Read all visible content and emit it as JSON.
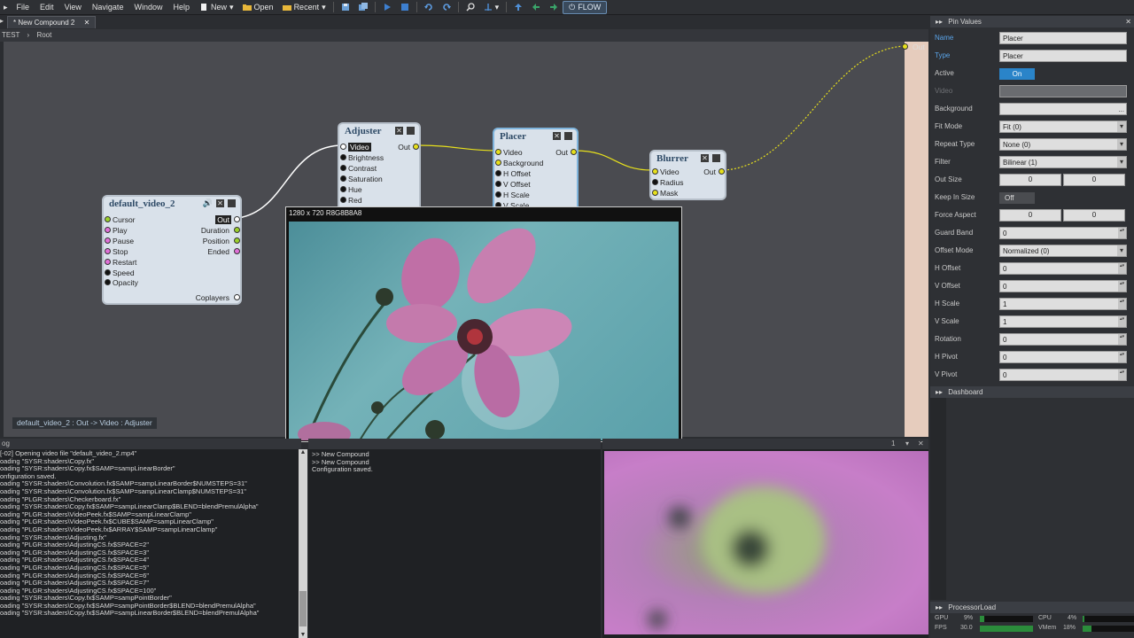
{
  "menu": [
    "File",
    "Edit",
    "View",
    "Navigate",
    "Window",
    "Help"
  ],
  "toolbar": {
    "new_label": "New",
    "open_label": "Open",
    "recent_label": "Recent",
    "flow_label": "FLOW"
  },
  "tab": {
    "label": "* New Compound 2"
  },
  "breadcrumb": {
    "left": "TEST",
    "root": "Root"
  },
  "graph": {
    "out_label": "Out",
    "status": "default_video_2 : Out  ->  Video : Adjuster",
    "nodes": {
      "video": {
        "title": "default_video_2",
        "pins_in": [
          "Cursor",
          "Play",
          "Pause",
          "Stop",
          "Restart",
          "Speed",
          "Opacity"
        ],
        "pins_out": [
          "Out",
          "Duration",
          "Position",
          "Ended"
        ],
        "bottom": "Coplayers"
      },
      "adjuster": {
        "title": "Adjuster",
        "pins_in": [
          "Video",
          "Brightness",
          "Contrast",
          "Saturation",
          "Hue",
          "Red"
        ],
        "out": "Out"
      },
      "placer": {
        "title": "Placer",
        "pins_in": [
          "Video",
          "Background",
          "H Offset",
          "V Offset",
          "H Scale",
          "V Scale"
        ],
        "out": "Out"
      },
      "blurrer": {
        "title": "Blurrer",
        "pins_in": [
          "Video",
          "Radius",
          "Mask"
        ],
        "out": "Out"
      }
    }
  },
  "popup": {
    "title": "1280 x 720  R8G8B8A8"
  },
  "pin_values": {
    "header": "Pin Values",
    "rows": [
      {
        "label": "Name",
        "value": "Placer",
        "kind": "text",
        "label_color": "#5aa4e8"
      },
      {
        "label": "Type",
        "value": "Placer",
        "kind": "text",
        "label_color": "#5aa4e8"
      },
      {
        "label": "Active",
        "value": "On",
        "kind": "toggle-on"
      },
      {
        "label": "Video",
        "value": "",
        "kind": "disabled"
      },
      {
        "label": "Background",
        "value": "",
        "kind": "dots"
      },
      {
        "label": "Fit Mode",
        "value": "Fit (0)",
        "kind": "drop"
      },
      {
        "label": "Repeat Type",
        "value": "None (0)",
        "kind": "drop"
      },
      {
        "label": "Filter",
        "value": "Bilinear (1)",
        "kind": "drop"
      },
      {
        "label": "Out Size",
        "value": "0",
        "value2": "0",
        "kind": "pair"
      },
      {
        "label": "Keep In Size",
        "value": "Off",
        "kind": "toggle-off"
      },
      {
        "label": "Force Aspect",
        "value": "0",
        "value2": "0",
        "kind": "pair"
      },
      {
        "label": "Guard Band",
        "value": "0",
        "kind": "spin"
      },
      {
        "label": "Offset Mode",
        "value": "Normalized (0)",
        "kind": "drop"
      },
      {
        "label": "H Offset",
        "value": "0",
        "kind": "spin"
      },
      {
        "label": "V Offset",
        "value": "0",
        "kind": "spin"
      },
      {
        "label": "H Scale",
        "value": "1",
        "kind": "spin"
      },
      {
        "label": "V Scale",
        "value": "1",
        "kind": "spin"
      },
      {
        "label": "Rotation",
        "value": "0",
        "kind": "spin"
      },
      {
        "label": "H Pivot",
        "value": "0",
        "kind": "spin"
      },
      {
        "label": "V Pivot",
        "value": "0",
        "kind": "spin"
      }
    ]
  },
  "dashboard": {
    "header": "Dashboard"
  },
  "processor": {
    "header": "ProcessorLoad",
    "gpu_label": "GPU",
    "gpu_value": "9%",
    "gpu_fraction": 0.09,
    "cpu_label": "CPU",
    "cpu_value": "4%",
    "cpu_fraction": 0.04,
    "fps_label": "FPS",
    "fps_value": "30.0",
    "fps_fraction": 1.0,
    "vmem_label": "VMem",
    "vmem_value": "18%",
    "vmem_fraction": 0.18
  },
  "log": {
    "header": "og",
    "lines": [
      "[-02] Opening video file \"default_video_2.mp4\"",
      "oading \"SYSR:shaders\\Copy.fx\"",
      "oading \"SYSR:shaders\\Copy.fx$SAMP=sampLinearBorder\"",
      "onfiguration saved.",
      "oading \"SYSR:shaders\\Convolution.fx$SAMP=sampLinearBorder$NUMSTEPS=31\"",
      "oading \"SYSR:shaders\\Convolution.fx$SAMP=sampLinearClamp$NUMSTEPS=31\"",
      "oading \"PLGR:shaders\\Checkerboard.fx\"",
      "oading \"SYSR:shaders\\Copy.fx$SAMP=sampLinearClamp$BLEND=blendPremulAlpha\"",
      "oading \"PLGR:shaders\\VideoPeek.fx$SAMP=sampLinearClamp\"",
      "oading \"PLGR:shaders\\VideoPeek.fx$CUBE$SAMP=sampLinearClamp\"",
      "oading \"PLGR:shaders\\VideoPeek.fx$ARRAY$SAMP=sampLinearClamp\"",
      "oading \"SYSR:shaders\\Adjusting.fx\"",
      "oading \"PLGR:shaders\\AdjustingCS.fx$SPACE=2\"",
      "oading \"PLGR:shaders\\AdjustingCS.fx$SPACE=3\"",
      "oading \"PLGR:shaders\\AdjustingCS.fx$SPACE=4\"",
      "oading \"PLGR:shaders\\AdjustingCS.fx$SPACE=5\"",
      "oading \"PLGR:shaders\\AdjustingCS.fx$SPACE=6\"",
      "oading \"PLGR:shaders\\AdjustingCS.fx$SPACE=7\"",
      "oading \"PLGR:shaders\\AdjustingCS.fx$SPACE=100\"",
      "oading \"SYSR:shaders\\Copy.fx$SAMP=sampPointBorder\"",
      "oading \"SYSR:shaders\\Copy.fx$SAMP=sampPointBorder$BLEND=blendPremulAlpha\"",
      "oading \"SYSR:shaders\\Copy.fx$SAMP=sampLinearBorder$BLEND=blendPremulAlpha\""
    ]
  },
  "console": {
    "lines": [
      ">> New Compound",
      ">> New Compound",
      "Configuration saved."
    ]
  },
  "preview2": {
    "page": "1"
  }
}
